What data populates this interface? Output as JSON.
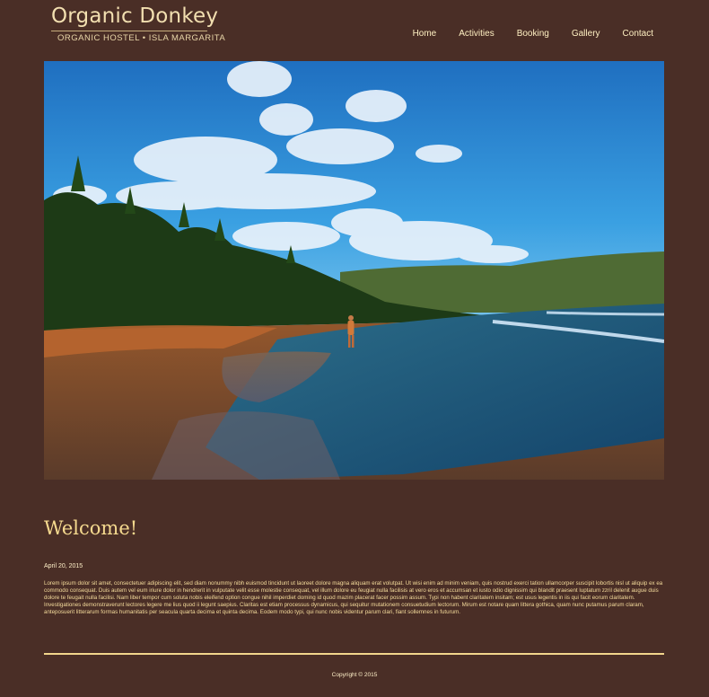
{
  "logo": {
    "title": "Organic Donkey",
    "subtitle": "ORGANIC HOSTEL • ISLA MARGARITA"
  },
  "nav": {
    "items": [
      {
        "label": "Home"
      },
      {
        "label": "Activities"
      },
      {
        "label": "Booking"
      },
      {
        "label": "Gallery"
      },
      {
        "label": "Contact"
      }
    ]
  },
  "content": {
    "heading": "Welcome!",
    "date": "April 20, 2015",
    "body": "Lorem ipsum dolor sit amet, consectetuer adipiscing elit, sed diam nonummy nibh euismod tincidunt ut laoreet dolore magna aliquam erat volutpat. Ut wisi enim ad minim veniam, quis nostrud exerci tation ullamcorper suscipit lobortis nisl ut aliquip ex ea commodo consequat. Duis autem vel eum iriure dolor in hendrerit in vulputate velit esse molestie consequat, vel illum dolore eu feugiat nulla facilisis at vero eros et accumsan et iusto odio dignissim qui blandit praesent luptatum zzril delenit augue duis dolore te feugait nulla facilisi. Nam liber tempor cum soluta nobis eleifend option congue nihil imperdiet doming id quod mazim placerat facer possim assum. Typi non habent claritatem insitam; est usus legentis in iis qui facit eorum claritatem. Investigationes demonstraverunt lectores legere me lius quod ii legunt saepius. Claritas est etiam processus dynamicus, qui sequitur mutationem consuetudium lectorum. Mirum est notare quam littera gothica, quam nunc putamus parum claram, anteposuerit litterarum formas humanitatis per seacula quarta decima et quinta decima. Eodem modo typi, qui nunc nobis videntur parum clari, fiant sollemnes in futurum."
  },
  "footer": {
    "copyright": "Copyright © 2015"
  },
  "colors": {
    "background": "#4a2e26",
    "accent": "#f6da8f",
    "nav_text": "#fff0c2"
  },
  "hero_image": {
    "icon": "beach-photo"
  }
}
